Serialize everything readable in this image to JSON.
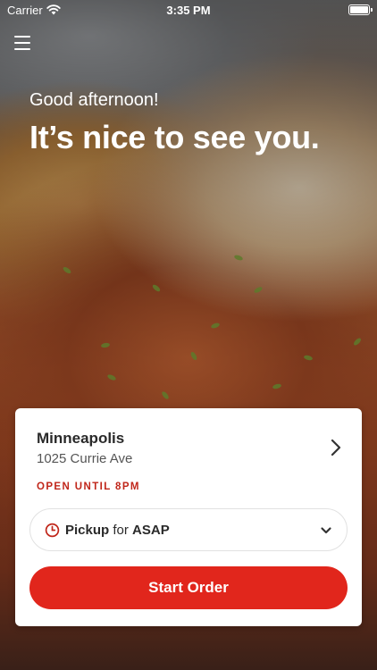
{
  "status_bar": {
    "carrier": "Carrier",
    "time": "3:35 PM"
  },
  "hero": {
    "greeting": "Good afternoon!",
    "headline": "It’s nice to see you."
  },
  "location_card": {
    "name": "Minneapolis",
    "address": "1025 Currie Ave",
    "open_status": "OPEN UNTIL 8PM",
    "pickup": {
      "mode": "Pickup",
      "connector": "for",
      "time": "ASAP"
    },
    "start_button": "Start Order"
  },
  "colors": {
    "accent": "#e1261c",
    "status_text": "#c0261a"
  },
  "icons": [
    "menu-icon",
    "wifi-icon",
    "battery-icon",
    "chevron-right-icon",
    "clock-icon",
    "chevron-down-icon"
  ]
}
